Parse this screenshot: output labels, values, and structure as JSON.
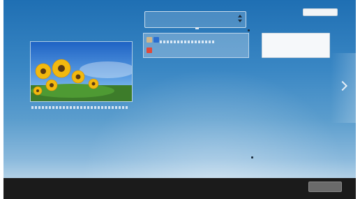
{
  "header": {
    "status_text": ""
  },
  "dropdown": {
    "label": ""
  },
  "info": {
    "row1_label": "",
    "row1_value": "",
    "row2_value": ""
  },
  "photo": {
    "subject": "sunflower-photo"
  },
  "description": {
    "line1": "",
    "line2": "",
    "line3": ""
  },
  "card": {
    "title": "",
    "line1": "",
    "line2": ""
  },
  "right_link": "",
  "next": {
    "label": ""
  },
  "bottom": {
    "left_text": "",
    "button_label": ""
  }
}
